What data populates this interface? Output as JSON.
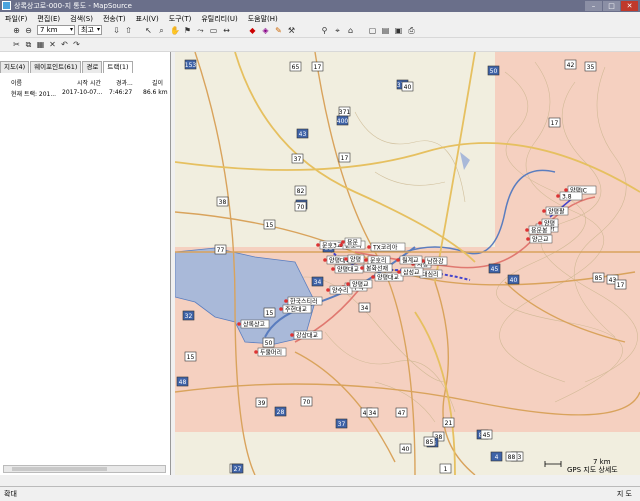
{
  "window": {
    "title": "상록상고로-000-지 통도 - MapSource"
  },
  "menu": [
    "파일(F)",
    "편집(E)",
    "검색(S)",
    "전송(T)",
    "표시(V)",
    "도구(T)",
    "유틸리티(U)",
    "도움말(H)"
  ],
  "toolbar": {
    "zoom_value": "7 km",
    "detail_value": "최고"
  },
  "tabs": [
    "지도(4)",
    "웨이포인트(61)",
    "경로",
    "트랙(1)"
  ],
  "tracks": {
    "columns": [
      "이름",
      "시작 시간",
      "경과...",
      "길이"
    ],
    "rows": [
      [
        "현재 트랙: 201...",
        "2017-10-07...",
        "7:46:27",
        "86.6 km"
      ]
    ]
  },
  "map": {
    "scale_label": "7 km",
    "footer_label": "GPS 지도 상세도",
    "waypoints": [
      "양평IC",
      "3.8",
      "문호3교",
      "문호리",
      "양평대교",
      "양평대교",
      "양평",
      "문호리",
      "TX코리아",
      "양평대교",
      "용문",
      "봉화선재",
      "시청",
      "대심리",
      "삼성교",
      "양수역",
      "양수리",
      "양평교",
      "상록상고",
      "한국스티러",
      "두물머리",
      "주헌대교",
      "강상대교",
      "남한강",
      "월계교",
      "상주하",
      "양평",
      "용문봉",
      "양평팔",
      "양근교"
    ],
    "road_shields": [
      "153",
      "65",
      "17",
      "50",
      "42",
      "35",
      "373",
      "40",
      "371",
      "400",
      "17",
      "17",
      "43",
      "37",
      "82",
      "77",
      "38",
      "77",
      "38",
      "15",
      "70",
      "34",
      "15",
      "34",
      "32",
      "50",
      "15",
      "48",
      "70",
      "39",
      "28",
      "46",
      "47",
      "37",
      "21",
      "34",
      "85",
      "45",
      "1",
      "27",
      "1",
      "38",
      "43",
      "40",
      "85",
      "4",
      "20",
      "43",
      "40",
      "88",
      "85",
      "45",
      "43",
      "17"
    ]
  },
  "status": {
    "left": "확대",
    "right": "지 도"
  }
}
